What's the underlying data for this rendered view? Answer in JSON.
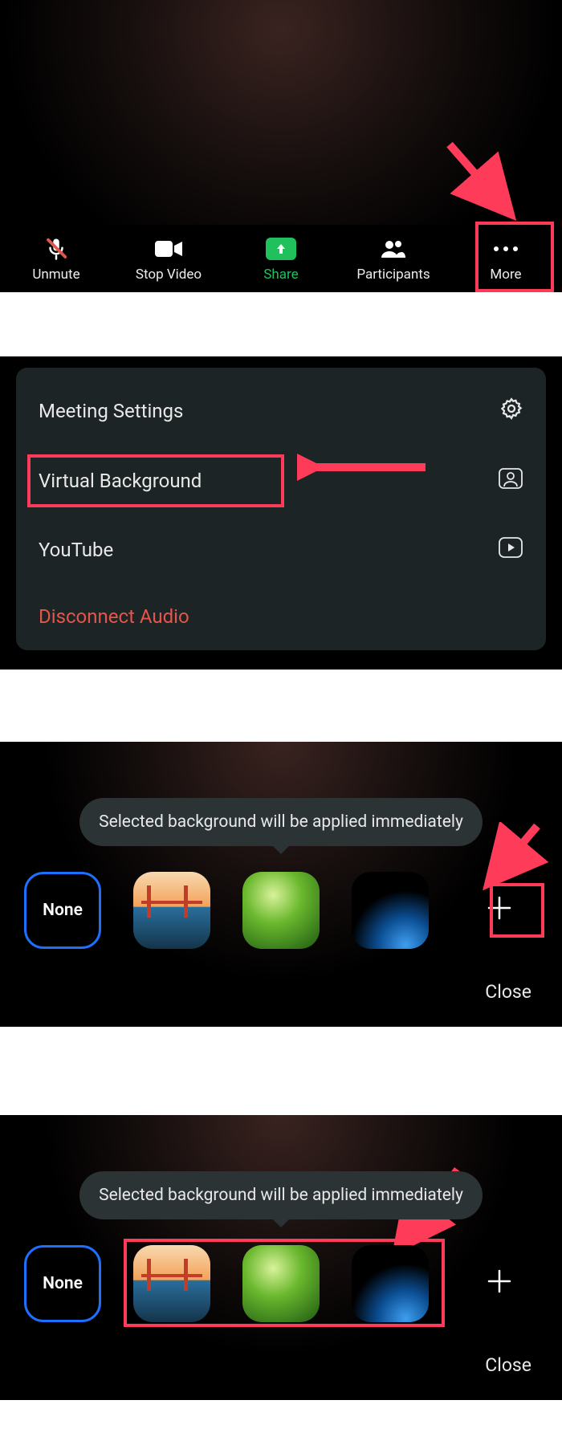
{
  "toolbar": {
    "unmute": "Unmute",
    "stop_video": "Stop Video",
    "share": "Share",
    "participants": "Participants",
    "more": "More"
  },
  "settings": {
    "meeting_settings": "Meeting Settings",
    "virtual_background": "Virtual Background",
    "youtube": "YouTube",
    "disconnect_audio": "Disconnect Audio"
  },
  "picker": {
    "tooltip": "Selected background will be applied immediately",
    "none_label": "None",
    "close": "Close"
  },
  "annotations": {
    "highlight_color": "#ff3b5a"
  }
}
